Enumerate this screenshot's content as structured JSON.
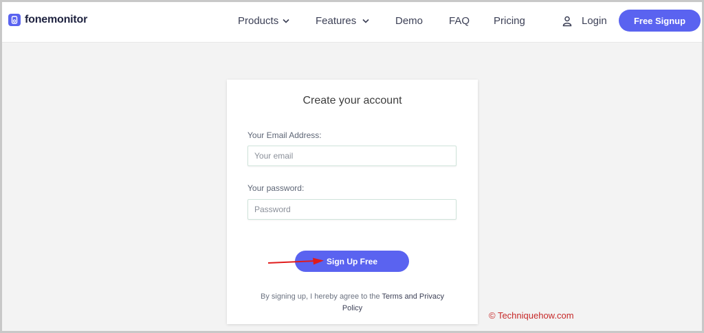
{
  "brand": {
    "name": "fonemonitor",
    "icon": "phone-logo-icon",
    "color": "#5a63f0"
  },
  "nav": {
    "items": [
      {
        "label": "Products",
        "has_dropdown": true
      },
      {
        "label": "Features",
        "has_dropdown": true
      },
      {
        "label": "Demo",
        "has_dropdown": false
      },
      {
        "label": "FAQ",
        "has_dropdown": false
      },
      {
        "label": "Pricing",
        "has_dropdown": false
      }
    ],
    "login_label": "Login",
    "signup_label": "Free Signup"
  },
  "form": {
    "title": "Create your account",
    "email_label": "Your Email Address:",
    "email_placeholder": "Your email",
    "password_label": "Your password:",
    "password_placeholder": "Password",
    "submit_label": "Sign Up Free",
    "terms_prefix": "By signing up, I hereby agree to the ",
    "terms_link": "Terms and Privacy",
    "terms_suffix": "Policy"
  },
  "annotation": {
    "arrow_color": "#e01b1b"
  },
  "watermark": "© Techniquehow.com"
}
